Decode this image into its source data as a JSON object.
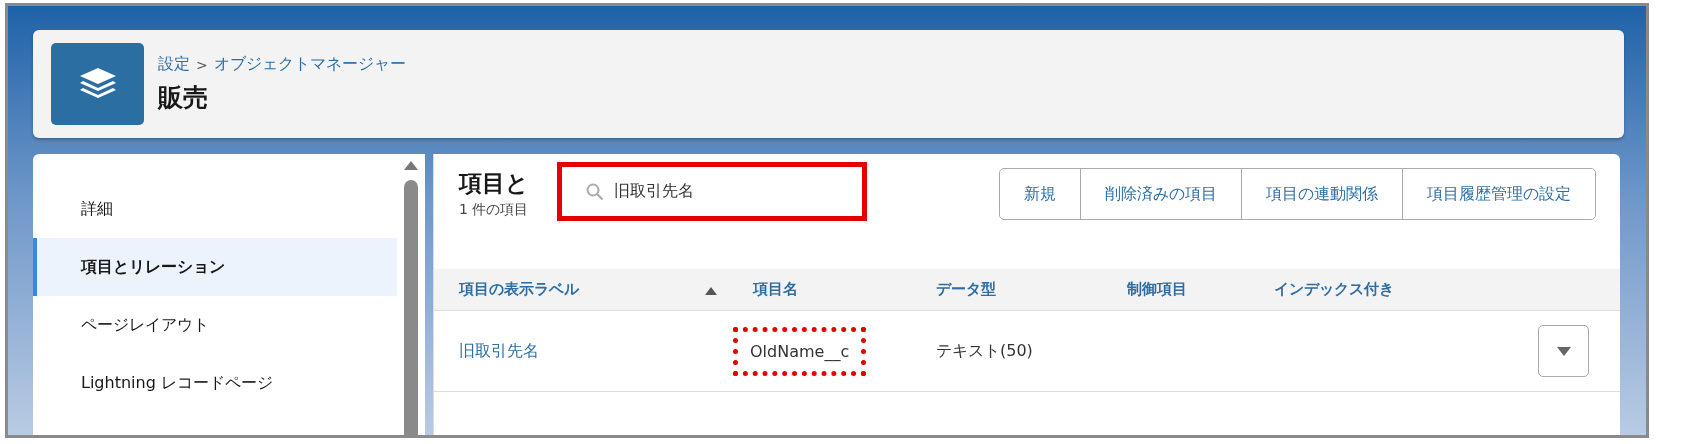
{
  "header": {
    "breadcrumb": [
      "設定",
      "オブジェクトマネージャー"
    ],
    "breadcrumb_separator": ">",
    "title": "販売"
  },
  "sidebar": {
    "items": [
      {
        "label": "詳細",
        "selected": false
      },
      {
        "label": "項目とリレーション",
        "selected": true
      },
      {
        "label": "ページレイアウト",
        "selected": false
      },
      {
        "label": "Lightning レコードページ",
        "selected": false
      }
    ]
  },
  "fields_panel": {
    "title": "項目と",
    "subtitle": "1 件の項目",
    "search": {
      "value": "旧取引先名",
      "highlighted": true
    },
    "buttons": [
      "新規",
      "削除済みの項目",
      "項目の連動関係",
      "項目履歴管理の設定"
    ],
    "table": {
      "columns": [
        {
          "label": "項目の表示ラベル",
          "sorted": true
        },
        {
          "label": "項目名",
          "sorted": false
        },
        {
          "label": "データ型",
          "sorted": false
        },
        {
          "label": "制御項目",
          "sorted": false
        },
        {
          "label": "インデックス付き",
          "sorted": false
        }
      ],
      "rows": [
        {
          "label": "旧取引先名",
          "api_name": "OldName__c",
          "api_name_highlighted": true,
          "data_type": "テキスト(50)"
        }
      ]
    }
  }
}
